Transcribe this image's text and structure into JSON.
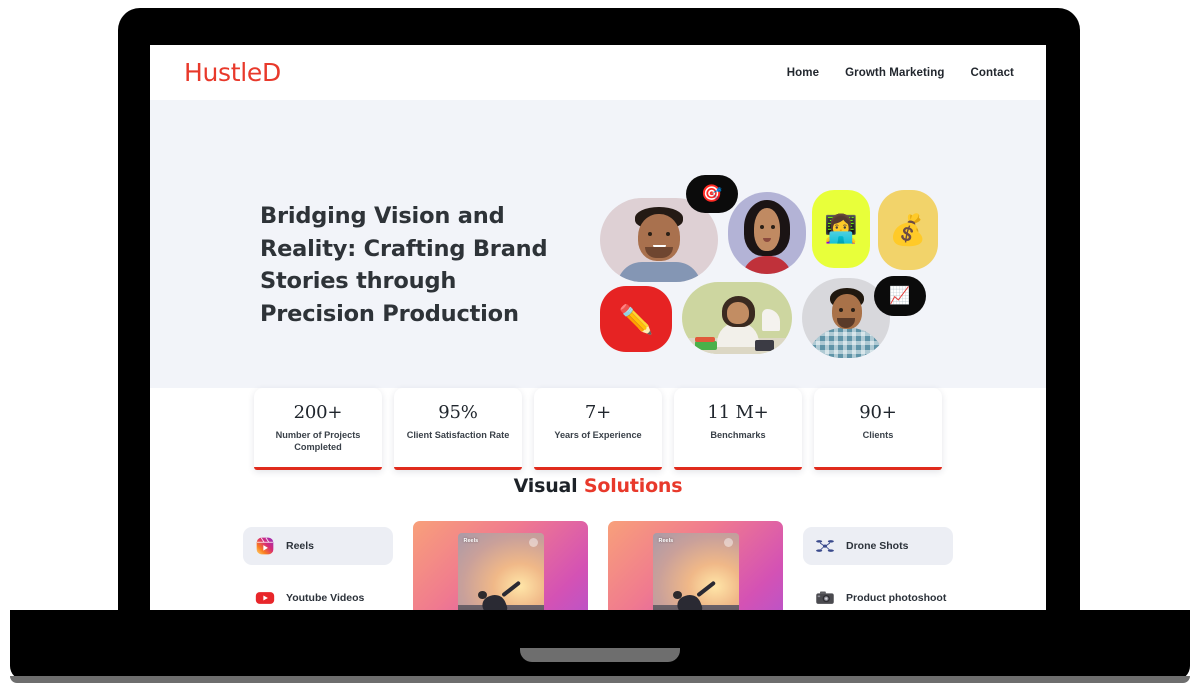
{
  "site": {
    "logo": "HustleD",
    "accent_red": "#e8392b",
    "hero_bg": "#f2f4f9"
  },
  "nav": {
    "links": [
      {
        "label": "Home",
        "name": "nav-link-home"
      },
      {
        "label": "Growth Marketing",
        "name": "nav-link-growth-marketing"
      },
      {
        "label": "Contact",
        "name": "nav-link-contact"
      }
    ]
  },
  "hero": {
    "title_lines": [
      "Bridging Vision and",
      "Reality: Crafting Brand",
      "Stories through",
      "Precision Production"
    ],
    "collage": {
      "tiles": [
        {
          "name": "collage-photo-man-smiling",
          "kind": "photo",
          "bg": "#ded0d4"
        },
        {
          "name": "collage-photo-woman-smiling",
          "kind": "photo",
          "bg": "#b3b3d6"
        },
        {
          "name": "collage-emoji-laptop-person",
          "kind": "emoji",
          "emoji": "👩‍💻",
          "bg": "#e8ff3a"
        },
        {
          "name": "collage-emoji-money-bag",
          "kind": "emoji",
          "emoji": "💰",
          "bg": "#f2d36a"
        },
        {
          "name": "collage-emoji-pencil",
          "kind": "emoji",
          "emoji": "✏️",
          "bg": "#e62323"
        },
        {
          "name": "collage-photo-woman-desk",
          "kind": "photo",
          "bg": "#cdd6a0"
        },
        {
          "name": "collage-photo-man-checkered-shirt",
          "kind": "photo",
          "bg": "#d8d8dc"
        }
      ],
      "bubbles": [
        {
          "name": "speech-bubble-target",
          "emoji": "🎯"
        },
        {
          "name": "speech-bubble-chart",
          "emoji": "📈"
        }
      ]
    }
  },
  "stats": {
    "cards": [
      {
        "value": "200+",
        "label": "Number of Projects Completed",
        "name": "stat-card-projects"
      },
      {
        "value": "95%",
        "label": "Client Satisfaction Rate",
        "name": "stat-card-satisfaction"
      },
      {
        "value": "7+",
        "label": "Years of Experience",
        "name": "stat-card-experience"
      },
      {
        "value": "11 M+",
        "label": "Benchmarks",
        "name": "stat-card-benchmarks"
      },
      {
        "value": "90+",
        "label": "Clients",
        "name": "stat-card-clients"
      }
    ]
  },
  "solutions": {
    "title_plain": "Visual ",
    "title_accent": "Solutions",
    "left_chips": [
      {
        "label": "Reels",
        "icon": "instagram-reels-icon",
        "active": true,
        "name": "solution-chip-reels"
      },
      {
        "label": "Youtube Videos",
        "icon": "youtube-icon",
        "active": false,
        "name": "solution-chip-youtube-videos"
      }
    ],
    "right_chips": [
      {
        "label": "Drone Shots",
        "icon": "drone-icon",
        "active": true,
        "name": "solution-chip-drone-shots"
      },
      {
        "label": "Product photoshoot",
        "icon": "camera-icon",
        "active": false,
        "name": "solution-chip-product-photoshoot"
      }
    ],
    "video_cards": [
      {
        "label": "Reels",
        "name": "solution-video-card-1"
      },
      {
        "label": "Reels",
        "name": "solution-video-card-2"
      }
    ]
  }
}
